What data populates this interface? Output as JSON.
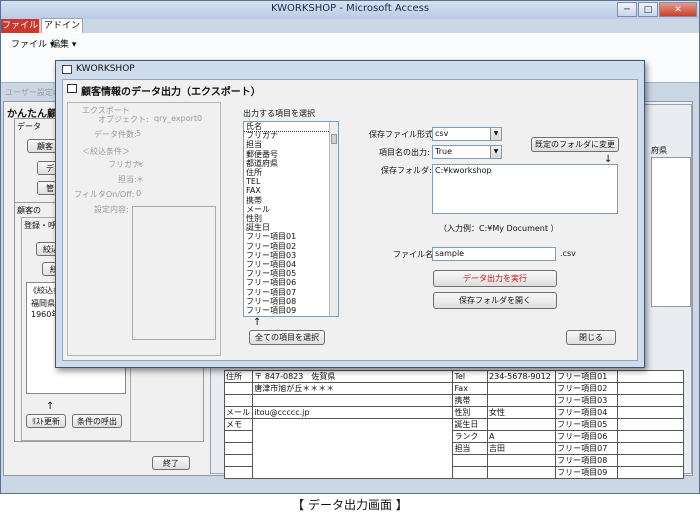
{
  "window": {
    "title": "KWORKSHOP - Microsoft Access",
    "min": "─",
    "max": "□",
    "close": "✕"
  },
  "ribbon": {
    "tab_file": "ファイル",
    "tab_addin": "アドイン",
    "menu_file": "ファイル ▾",
    "menu_edit": "編集 ▾"
  },
  "back": {
    "user_settings": "ユーザー設定の",
    "section_title": "かんたん顧",
    "group1": "データ",
    "btn_customer": "顧客",
    "btn_data": "デ",
    "btn_manage": "管",
    "group2": "顧客の",
    "reg_label": "登録・呼",
    "btn_a": "絞込",
    "btn_b": "絞",
    "filter_note": "《絞込条",
    "filter_line1": "福岡県",
    "filter_line2": "1960年",
    "arrow": "↑",
    "btn_list_update": "ﾘｽﾄ更新",
    "btn_cond_call": "条件の呼出",
    "btn_end": "終了",
    "right_header": "府県",
    "detail": {
      "addr_label": "住所",
      "zip": "〒 847-0823　佐賀県",
      "addr": "唐津市旭が丘＊＊＊＊",
      "mail_label": "メール",
      "mail": "itou@ccccc.jp",
      "memo_label": "メモ",
      "rows": [
        {
          "k": "Tel",
          "v": "234-5678-9012"
        },
        {
          "k": "Fax",
          "v": ""
        },
        {
          "k": "携帯",
          "v": ""
        },
        {
          "k": "性別",
          "v": "女性"
        },
        {
          "k": "誕生日",
          "v": ""
        },
        {
          "k": "ランク",
          "v": "A"
        },
        {
          "k": "担当",
          "v": "吉田"
        }
      ],
      "free_items": [
        "フリー項目01",
        "フリー項目02",
        "フリー項目03",
        "フリー項目04",
        "フリー項目05",
        "フリー項目06",
        "フリー項目07",
        "フリー項目08",
        "フリー項目09"
      ]
    }
  },
  "dialog": {
    "title": "KWORKSHOP",
    "heading": "顧客情報のデータ出力（エクスポート）",
    "export_label": "エクスポート",
    "object_label": "オブジェクト:",
    "object_value": "qry_export0",
    "count_label": "データ件数:",
    "count_value": "5",
    "filter_header": "＜絞込条件＞",
    "furigana_label": "フリガナ:",
    "furigana_value": "＊",
    "tantou_label": "担当:",
    "tantou_value": "＊",
    "filter_onoff_label": "フィルタOn/Off:",
    "filter_onoff_value": "0",
    "settings_label": "設定内容:",
    "items_label": "出力する項目を選択",
    "items": [
      "氏名",
      "フリガナ",
      "担当",
      "郵便番号",
      "都道府県",
      "住所",
      "TEL",
      "FAX",
      "携帯",
      "メール",
      "性別",
      "誕生日",
      "フリー項目01",
      "フリー項目02",
      "フリー項目03",
      "フリー項目04",
      "フリー項目05",
      "フリー項目06",
      "フリー項目07",
      "フリー項目08",
      "フリー項目09"
    ],
    "items_arrow": "↑",
    "btn_select_all": "全ての項目を選択",
    "format_label": "保存ファイル形式:",
    "format_value": "csv",
    "header_out_label": "項目名の出力:",
    "header_out_value": "True",
    "btn_default_folder": "既定のフォルダに変更",
    "folder_arrow": "↓",
    "folder_label": "保存フォルダ:",
    "folder_value": "C:¥kworkshop",
    "folder_example": "（入力例：C:¥My Document ）",
    "filename_label": "ファイル名:",
    "filename_value": "sample",
    "ext": ".csv",
    "btn_run": "データ出力を実行",
    "btn_open_folder": "保存フォルダを開く",
    "btn_close": "閉じる"
  },
  "caption": "【 データ出力画面 】"
}
